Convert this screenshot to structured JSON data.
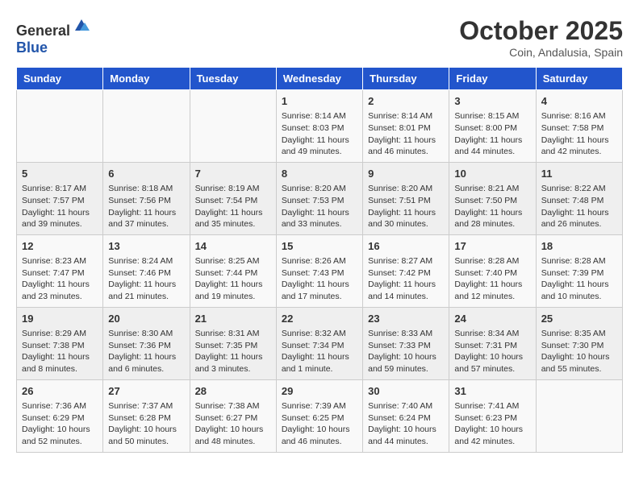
{
  "header": {
    "logo_general": "General",
    "logo_blue": "Blue",
    "month": "October 2025",
    "location": "Coin, Andalusia, Spain"
  },
  "days_of_week": [
    "Sunday",
    "Monday",
    "Tuesday",
    "Wednesday",
    "Thursday",
    "Friday",
    "Saturday"
  ],
  "weeks": [
    [
      {
        "day": "",
        "info": ""
      },
      {
        "day": "",
        "info": ""
      },
      {
        "day": "",
        "info": ""
      },
      {
        "day": "1",
        "info": "Sunrise: 8:14 AM\nSunset: 8:03 PM\nDaylight: 11 hours\nand 49 minutes."
      },
      {
        "day": "2",
        "info": "Sunrise: 8:14 AM\nSunset: 8:01 PM\nDaylight: 11 hours\nand 46 minutes."
      },
      {
        "day": "3",
        "info": "Sunrise: 8:15 AM\nSunset: 8:00 PM\nDaylight: 11 hours\nand 44 minutes."
      },
      {
        "day": "4",
        "info": "Sunrise: 8:16 AM\nSunset: 7:58 PM\nDaylight: 11 hours\nand 42 minutes."
      }
    ],
    [
      {
        "day": "5",
        "info": "Sunrise: 8:17 AM\nSunset: 7:57 PM\nDaylight: 11 hours\nand 39 minutes."
      },
      {
        "day": "6",
        "info": "Sunrise: 8:18 AM\nSunset: 7:56 PM\nDaylight: 11 hours\nand 37 minutes."
      },
      {
        "day": "7",
        "info": "Sunrise: 8:19 AM\nSunset: 7:54 PM\nDaylight: 11 hours\nand 35 minutes."
      },
      {
        "day": "8",
        "info": "Sunrise: 8:20 AM\nSunset: 7:53 PM\nDaylight: 11 hours\nand 33 minutes."
      },
      {
        "day": "9",
        "info": "Sunrise: 8:20 AM\nSunset: 7:51 PM\nDaylight: 11 hours\nand 30 minutes."
      },
      {
        "day": "10",
        "info": "Sunrise: 8:21 AM\nSunset: 7:50 PM\nDaylight: 11 hours\nand 28 minutes."
      },
      {
        "day": "11",
        "info": "Sunrise: 8:22 AM\nSunset: 7:48 PM\nDaylight: 11 hours\nand 26 minutes."
      }
    ],
    [
      {
        "day": "12",
        "info": "Sunrise: 8:23 AM\nSunset: 7:47 PM\nDaylight: 11 hours\nand 23 minutes."
      },
      {
        "day": "13",
        "info": "Sunrise: 8:24 AM\nSunset: 7:46 PM\nDaylight: 11 hours\nand 21 minutes."
      },
      {
        "day": "14",
        "info": "Sunrise: 8:25 AM\nSunset: 7:44 PM\nDaylight: 11 hours\nand 19 minutes."
      },
      {
        "day": "15",
        "info": "Sunrise: 8:26 AM\nSunset: 7:43 PM\nDaylight: 11 hours\nand 17 minutes."
      },
      {
        "day": "16",
        "info": "Sunrise: 8:27 AM\nSunset: 7:42 PM\nDaylight: 11 hours\nand 14 minutes."
      },
      {
        "day": "17",
        "info": "Sunrise: 8:28 AM\nSunset: 7:40 PM\nDaylight: 11 hours\nand 12 minutes."
      },
      {
        "day": "18",
        "info": "Sunrise: 8:28 AM\nSunset: 7:39 PM\nDaylight: 11 hours\nand 10 minutes."
      }
    ],
    [
      {
        "day": "19",
        "info": "Sunrise: 8:29 AM\nSunset: 7:38 PM\nDaylight: 11 hours\nand 8 minutes."
      },
      {
        "day": "20",
        "info": "Sunrise: 8:30 AM\nSunset: 7:36 PM\nDaylight: 11 hours\nand 6 minutes."
      },
      {
        "day": "21",
        "info": "Sunrise: 8:31 AM\nSunset: 7:35 PM\nDaylight: 11 hours\nand 3 minutes."
      },
      {
        "day": "22",
        "info": "Sunrise: 8:32 AM\nSunset: 7:34 PM\nDaylight: 11 hours\nand 1 minute."
      },
      {
        "day": "23",
        "info": "Sunrise: 8:33 AM\nSunset: 7:33 PM\nDaylight: 10 hours\nand 59 minutes."
      },
      {
        "day": "24",
        "info": "Sunrise: 8:34 AM\nSunset: 7:31 PM\nDaylight: 10 hours\nand 57 minutes."
      },
      {
        "day": "25",
        "info": "Sunrise: 8:35 AM\nSunset: 7:30 PM\nDaylight: 10 hours\nand 55 minutes."
      }
    ],
    [
      {
        "day": "26",
        "info": "Sunrise: 7:36 AM\nSunset: 6:29 PM\nDaylight: 10 hours\nand 52 minutes."
      },
      {
        "day": "27",
        "info": "Sunrise: 7:37 AM\nSunset: 6:28 PM\nDaylight: 10 hours\nand 50 minutes."
      },
      {
        "day": "28",
        "info": "Sunrise: 7:38 AM\nSunset: 6:27 PM\nDaylight: 10 hours\nand 48 minutes."
      },
      {
        "day": "29",
        "info": "Sunrise: 7:39 AM\nSunset: 6:25 PM\nDaylight: 10 hours\nand 46 minutes."
      },
      {
        "day": "30",
        "info": "Sunrise: 7:40 AM\nSunset: 6:24 PM\nDaylight: 10 hours\nand 44 minutes."
      },
      {
        "day": "31",
        "info": "Sunrise: 7:41 AM\nSunset: 6:23 PM\nDaylight: 10 hours\nand 42 minutes."
      },
      {
        "day": "",
        "info": ""
      }
    ]
  ]
}
